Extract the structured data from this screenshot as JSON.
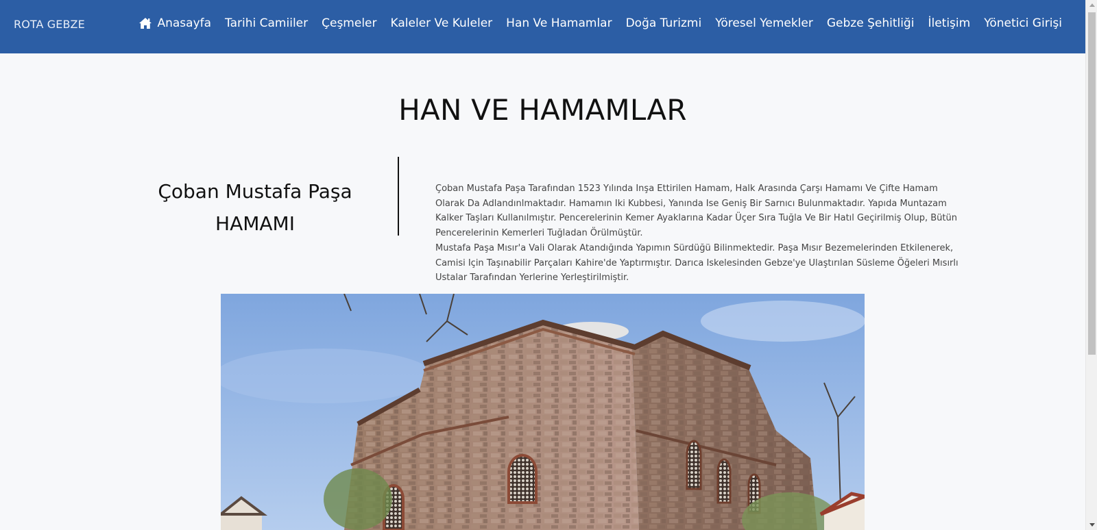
{
  "navbar": {
    "brand": "ROTA GEBZE",
    "items": [
      {
        "label": "Anasayfa",
        "icon": "home-icon"
      },
      {
        "label": "Tarihi Camiiler"
      },
      {
        "label": "Çeşmeler"
      },
      {
        "label": "Kaleler Ve Kuleler"
      },
      {
        "label": "Han Ve Hamamlar"
      },
      {
        "label": "Doğa Turizmi"
      },
      {
        "label": "Yöresel Yemekler"
      },
      {
        "label": "Gebze Şehitliği"
      },
      {
        "label": "İletişim"
      },
      {
        "label": "Yönetici Girişi"
      }
    ],
    "bg_color": "#2c5ea5"
  },
  "page": {
    "title": "HAN VE HAMAMLAR"
  },
  "section": {
    "heading_line1": "Çoban Mustafa Paşa",
    "heading_line2": "HAMAMI",
    "paragraph1": "Çoban Mustafa Paşa Tarafından 1523 Yılında Inşa Ettirilen Hamam, Halk Arasında Çarşı Hamamı Ve Çifte Hamam Olarak Da Adlandınlmaktadır. Hamamın Iki Kubbesi, Yanında Ise Geniş Bir Sarnıcı Bulunmaktadır. Yapıda Muntazam Kalker Taşları Kullanılmıştır. Pencerelerinin Kemer Ayaklarına Kadar Üçer Sıra Tuğla Ve Bir Hatıl Geçirilmiş Olup, Bütün Pencerelerinin Kemerleri Tuğladan Örülmüştür.",
    "paragraph2": "Mustafa Paşa Mısır'a Vali Olarak Atandığında Yapımın Sürdüğü Bilinmektedir. Paşa Mısır Bezemelerinden Etkilenerek, Camisi Için Taşınabilir Parçaları Kahire'de Yaptırmıştır. Darıca Iskelesinden Gebze'ye Ulaştırılan Süsleme Öğeleri Mısırlı Ustalar Tarafından Yerlerine Yerleştirilmiştir."
  }
}
